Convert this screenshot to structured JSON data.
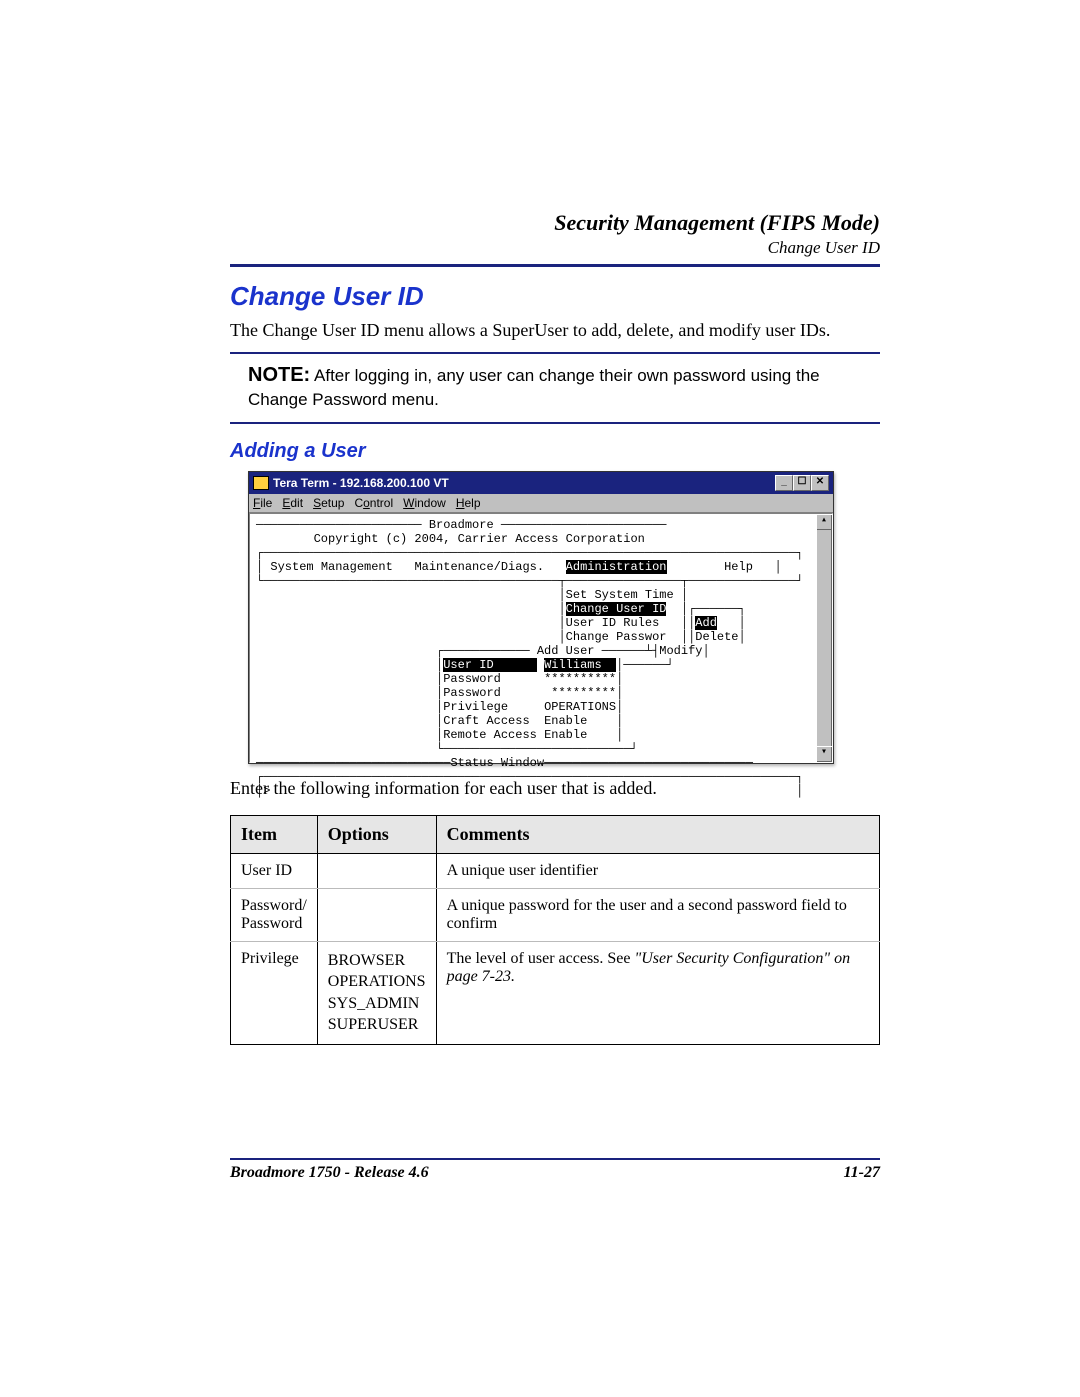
{
  "header": {
    "title": "Security Management (FIPS Mode)",
    "subtitle": "Change User ID"
  },
  "section": {
    "title": "Change User ID",
    "intro": "The Change User ID menu allows a SuperUser to add, delete, and modify user IDs."
  },
  "note": {
    "label": "NOTE:",
    "text": "After logging in, any user can change their own password using the Change Password menu."
  },
  "subsection": {
    "title": "Adding a User"
  },
  "terminal": {
    "window_title": "Tera Term - 192.168.200.100 VT",
    "menu": [
      "File",
      "Edit",
      "Setup",
      "Control",
      "Window",
      "Help"
    ],
    "banner1": "Broadmore",
    "banner2": "Copyright (c) 2004, Carrier Access Corporation",
    "top_menu": [
      "System Management",
      "Maintenance/Diags.",
      "Administration",
      "Help"
    ],
    "dropdown": [
      "Set System Time",
      "Change User ID",
      "User ID Rules",
      "Change Passwor"
    ],
    "side_menu": [
      "Add",
      "Delete",
      "Modify"
    ],
    "dialog_title": "Add User",
    "fields": [
      {
        "label": "User ID",
        "value": "Williams"
      },
      {
        "label": "Password",
        "value": "**********"
      },
      {
        "label": "Password",
        "value": "*********"
      },
      {
        "label": "Privilege",
        "value": "OPERATIONS"
      },
      {
        "label": "Craft Access",
        "value": "Enable"
      },
      {
        "label": "Remote Access",
        "value": "Enable"
      }
    ],
    "status_label": "Status Window",
    "prompt": ">"
  },
  "after_image": "Enter the following information for each user that is added.",
  "table": {
    "headers": [
      "Item",
      "Options",
      "Comments"
    ],
    "rows": [
      {
        "item": "User ID",
        "options": "",
        "comments": "A unique user identifier"
      },
      {
        "item": "Password/ Password",
        "options": "",
        "comments": "A unique password for the user and a second password field to confirm"
      },
      {
        "item": "Privilege",
        "options": [
          "BROWSER",
          "OPERATIONS",
          "SYS_ADMIN",
          "SUPERUSER"
        ],
        "comments_pre": "The level of user access. See ",
        "comments_ref": "\"User Security Configuration\" on page 7-23."
      }
    ]
  },
  "footer": {
    "left": "Broadmore 1750 - Release 4.6",
    "right": "11-27"
  }
}
